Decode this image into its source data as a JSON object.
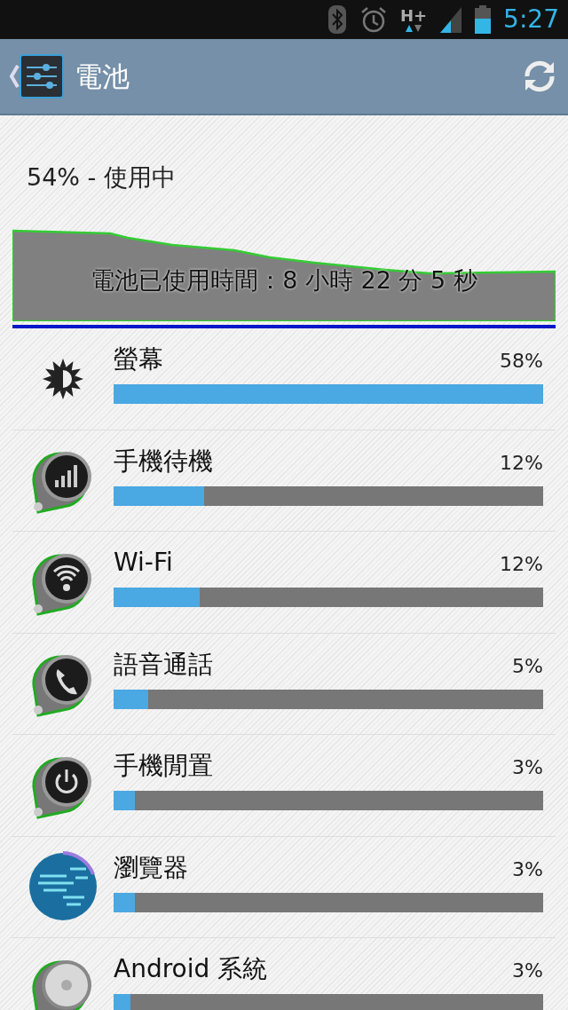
{
  "status_bar": {
    "network": "H+",
    "time": "5:27"
  },
  "action_bar": {
    "title": "電池"
  },
  "summary": "54% - 使用中",
  "history": {
    "caption": "電池已使用時間：8 小時 22 分 5 秒"
  },
  "items": [
    {
      "name": "螢幕",
      "percent": "58%",
      "level": 1.0,
      "kind": "brightness"
    },
    {
      "name": "手機待機",
      "percent": "12%",
      "level": 0.21,
      "kind": "signal"
    },
    {
      "name": "Wi-Fi",
      "percent": "12%",
      "level": 0.2,
      "kind": "wifi"
    },
    {
      "name": "語音通話",
      "percent": "5%",
      "level": 0.08,
      "kind": "phone"
    },
    {
      "name": "手機閒置",
      "percent": "3%",
      "level": 0.05,
      "kind": "power"
    },
    {
      "name": "瀏覽器",
      "percent": "3%",
      "level": 0.05,
      "kind": "globe"
    },
    {
      "name": "Android 系統",
      "percent": "3%",
      "level": 0.04,
      "kind": "system"
    }
  ]
}
